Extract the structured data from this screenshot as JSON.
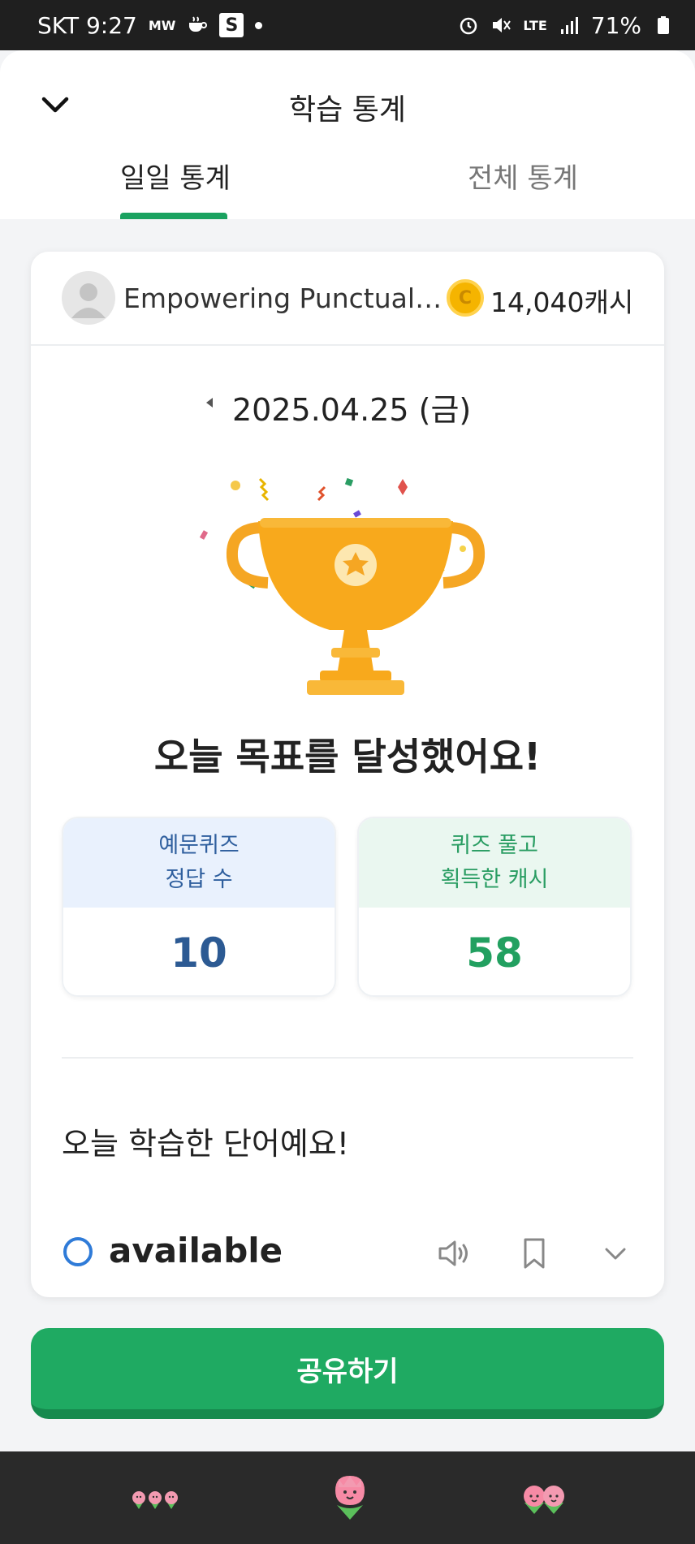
{
  "status_bar": {
    "carrier_time": "SKT 9:27",
    "mw_label": "MW",
    "s_badge": "S",
    "lte_label": "LTE",
    "battery": "71%"
  },
  "header": {
    "title": "학습 통계",
    "tabs": [
      {
        "label": "일일 통계",
        "active": true
      },
      {
        "label": "전체 통계",
        "active": false
      }
    ],
    "accent_color": "#1aa260"
  },
  "card": {
    "user_name": "Empowering Punctual ...",
    "cash": "14,040캐시",
    "date": "2025.04.25 (금)",
    "goal_message": "오늘 목표를 달성했어요!",
    "stats": [
      {
        "label_line1": "예문퀴즈",
        "label_line2": "정답 수",
        "value": "10",
        "color": "#2c5a93"
      },
      {
        "label_line1": "퀴즈 풀고",
        "label_line2": "획득한 캐시",
        "value": "58",
        "color": "#22a060"
      }
    ],
    "words_title": "오늘 학습한 단어예요!",
    "words": [
      {
        "word": "available"
      }
    ]
  },
  "share_button": {
    "label": "공유하기",
    "color": "#1faa62"
  },
  "bottom_nav": {
    "items": [
      {
        "icon": "three-flowers-icon"
      },
      {
        "icon": "single-flower-icon"
      },
      {
        "icon": "two-flowers-icon"
      }
    ]
  }
}
